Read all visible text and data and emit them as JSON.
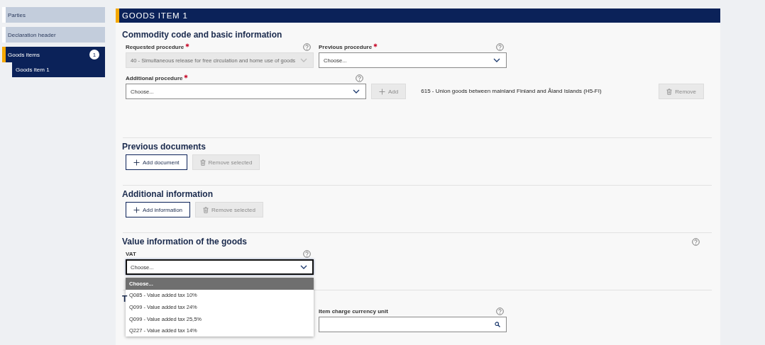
{
  "sidebar": {
    "items": [
      {
        "label": "Parties",
        "selected": false
      },
      {
        "label": "Declaration header",
        "selected": false
      },
      {
        "label": "Goods items",
        "selected": true,
        "badge": "1",
        "children": [
          {
            "label": "Goods item 1",
            "selected": true
          }
        ]
      }
    ]
  },
  "header": {
    "title": "GOODS ITEM 1"
  },
  "sections": [
    {
      "title": "Commodity code and basic information",
      "rows": [
        [
          {
            "kind": "select",
            "label": "Requested procedure",
            "required": true,
            "help": true,
            "value": "40 - Simultaneous release for free circulation and home use of goods",
            "disabled": true
          },
          {
            "kind": "select",
            "label": "Previous procedure",
            "required": true,
            "help": true,
            "value": "Choose..."
          }
        ],
        [
          {
            "kind": "select",
            "label": "Additional procedure",
            "required": true,
            "help": true,
            "value": "Choose..."
          },
          {
            "kind": "add",
            "label": "Add",
            "disabled": true
          },
          {
            "kind": "text",
            "text": "615 - Union goods between mainland Finland and Åland Islands (H5-FI)"
          },
          {
            "kind": "remove",
            "label": "Remove",
            "disabled": true
          }
        ]
      ]
    },
    {
      "title": "Previous documents",
      "rows": [
        [
          {
            "kind": "add",
            "label": "Add document",
            "disabled": false
          },
          {
            "kind": "remove",
            "label": "Remove selected",
            "disabled": true
          }
        ]
      ]
    },
    {
      "title": "Additional information",
      "rows": [
        [
          {
            "kind": "add",
            "label": "Add information",
            "disabled": false
          },
          {
            "kind": "remove",
            "label": "Remove selected",
            "disabled": true
          }
        ]
      ]
    },
    {
      "title": "Value information of the goods",
      "help": true,
      "rows": [
        [
          {
            "kind": "select",
            "label": "VAT",
            "required": false,
            "help": true,
            "value": "Choose...",
            "focused": true,
            "expanded": true,
            "options": [
              {
                "label": "Choose...",
                "selected": true
              },
              {
                "label": "Q085 - Value added tax 10%",
                "selected": false
              },
              {
                "label": "Q099 - Value added tax 24%",
                "selected": false
              },
              {
                "label": "Q099 - Value added tax 25,5%",
                "selected": false
              },
              {
                "label": "Q227 - Value added tax 14%",
                "selected": false
              }
            ]
          }
        ]
      ]
    },
    {
      "title": "T",
      "rows": [
        [
          {
            "kind": "search",
            "label": "Item charge currency unit",
            "required": false,
            "help": true
          }
        ]
      ]
    }
  ]
}
